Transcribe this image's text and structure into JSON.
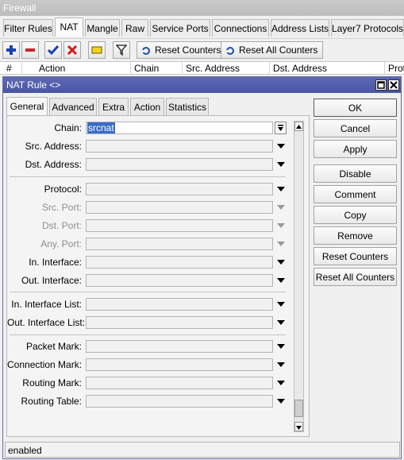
{
  "firewall": {
    "title": "Firewall",
    "tabs": [
      {
        "label": "Filter Rules"
      },
      {
        "label": "NAT"
      },
      {
        "label": "Mangle"
      },
      {
        "label": "Raw"
      },
      {
        "label": "Service Ports"
      },
      {
        "label": "Connections"
      },
      {
        "label": "Address Lists"
      },
      {
        "label": "Layer7 Protocols"
      }
    ],
    "active_tab": "NAT",
    "toolbar": {
      "reset_counters_label": "Reset Counters",
      "reset_all_counters_label": "Reset All Counters"
    },
    "columns": [
      "#",
      "Action",
      "Chain",
      "Src. Address",
      "Dst. Address",
      "Proto"
    ]
  },
  "dialog": {
    "title": "NAT Rule <>",
    "tabs": [
      {
        "label": "General"
      },
      {
        "label": "Advanced"
      },
      {
        "label": "Extra"
      },
      {
        "label": "Action"
      },
      {
        "label": "Statistics"
      }
    ],
    "active_tab": "General",
    "fields": [
      {
        "label": "Chain:",
        "value": "srcnat",
        "enabled": true
      },
      {
        "label": "Src. Address:",
        "value": "",
        "enabled": true
      },
      {
        "label": "Dst. Address:",
        "value": "",
        "enabled": true
      },
      {
        "label": "Protocol:",
        "value": "",
        "enabled": true
      },
      {
        "label": "Src. Port:",
        "value": "",
        "enabled": false
      },
      {
        "label": "Dst. Port:",
        "value": "",
        "enabled": false
      },
      {
        "label": "Any. Port:",
        "value": "",
        "enabled": false
      },
      {
        "label": "In. Interface:",
        "value": "",
        "enabled": true
      },
      {
        "label": "Out. Interface:",
        "value": "",
        "enabled": true
      },
      {
        "label": "In. Interface List:",
        "value": "",
        "enabled": true
      },
      {
        "label": "Out. Interface List:",
        "value": "",
        "enabled": true
      },
      {
        "label": "Packet Mark:",
        "value": "",
        "enabled": true
      },
      {
        "label": "Connection Mark:",
        "value": "",
        "enabled": true
      },
      {
        "label": "Routing Mark:",
        "value": "",
        "enabled": true
      },
      {
        "label": "Routing Table:",
        "value": "",
        "enabled": true
      }
    ],
    "buttons": [
      {
        "label": "OK"
      },
      {
        "label": "Cancel"
      },
      {
        "label": "Apply"
      },
      {
        "label": "Disable"
      },
      {
        "label": "Comment"
      },
      {
        "label": "Copy"
      },
      {
        "label": "Remove"
      },
      {
        "label": "Reset Counters"
      },
      {
        "label": "Reset All Counters"
      }
    ],
    "status": "enabled"
  },
  "colors": {
    "dialog_title_bg": "#4f5bab",
    "selection": "#3a6bc9",
    "add_icon": "#1a3fb5",
    "remove_icon": "#c8252b",
    "check_icon": "#1a3fb5",
    "x_icon": "#d11a1a",
    "comment_icon": "#f2d21e"
  },
  "icons": [
    "add-icon",
    "remove-icon",
    "enable-check-icon",
    "disable-x-icon",
    "comment-icon",
    "filter-icon",
    "reset-counters-icon"
  ]
}
